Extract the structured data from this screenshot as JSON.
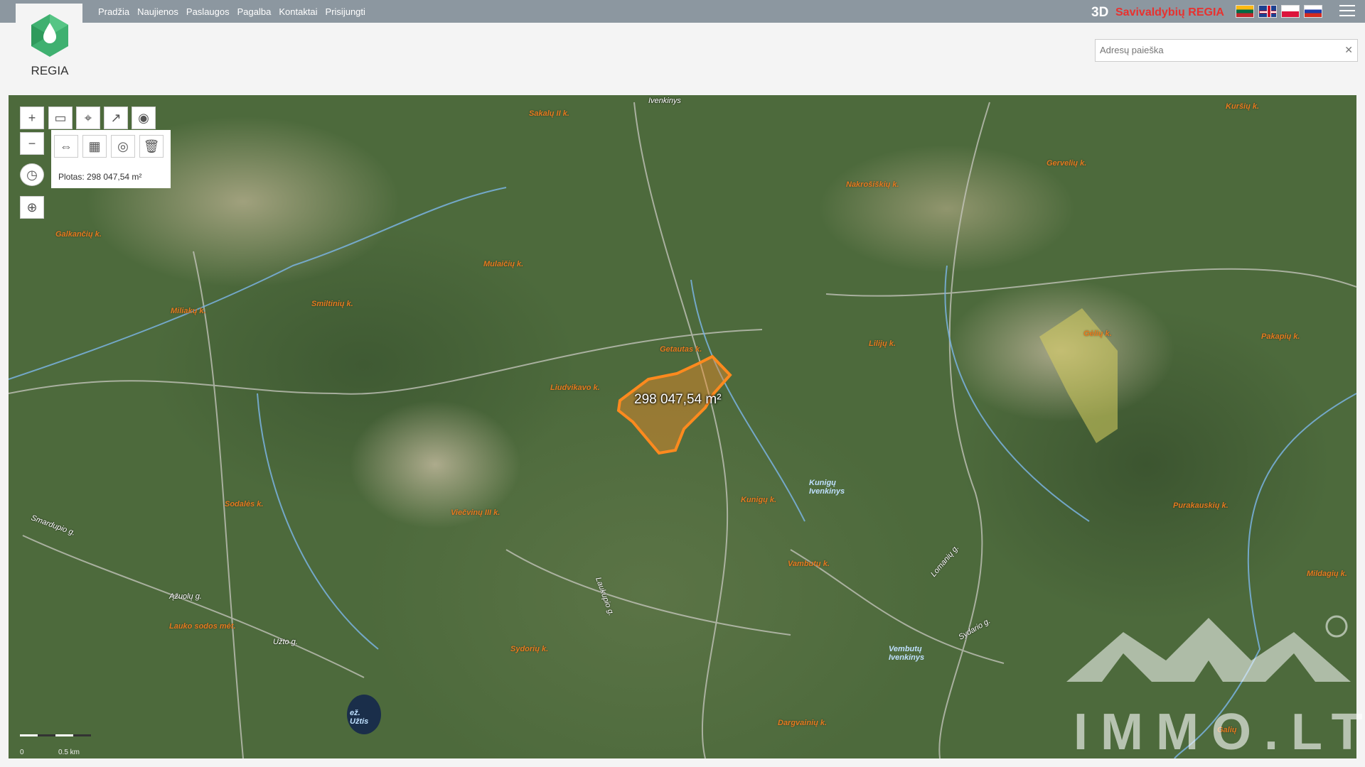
{
  "nav": {
    "items": [
      "Pradžia",
      "Naujienos",
      "Paslaugos",
      "Pagalba",
      "Kontaktai",
      "Prisijungti"
    ]
  },
  "brand": {
    "three_d": "3D",
    "name": "Savivaldybių REGIA",
    "logo_text": "REGIA",
    "accent_color": "#e8312f",
    "logo_color": "#3fb070"
  },
  "languages": [
    "lt-flag",
    "en-flag",
    "pl-flag",
    "ru-flag"
  ],
  "search": {
    "placeholder": "Adresų paieška",
    "value": ""
  },
  "measure": {
    "area_readout": "Plotas: 298 047,54 m²",
    "polygon_label": "298 047,54 m²"
  },
  "map": {
    "place_labels": [
      "Sakalų II k.",
      "Kuršių k.",
      "Gervelių k.",
      "Nakrošiškių k.",
      "Galkančių k.",
      "Mulaičių k.",
      "Smiltinių k.",
      "Miliakų k.",
      "Getautas k.",
      "Liudvikavo k.",
      "Lilijų k.",
      "Gėlių k.",
      "Pakapių k.",
      "Kunigų Ivenkinys",
      "Kunigų k.",
      "Sodalės k.",
      "Viečvinų III k.",
      "Vambutų k.",
      "Mildagių k.",
      "Purakauskių k.",
      "Lauko sodos mėt.",
      "Sydorių k.",
      "Vembutų Ivenkinys",
      "Dargvainių k.",
      "Galių"
    ],
    "road_labels": [
      "Ivenkinys",
      "Smardupio g.",
      "Užto g.",
      "Laukupio g.",
      "Ąžuolų g.",
      "Sydario g.",
      "Lomanių g."
    ],
    "water_labels": [
      "ež. Užtis"
    ],
    "scale_label": "0.5 km",
    "scale_zero": "0"
  },
  "watermark": {
    "text": "IMMO.LT"
  },
  "tools": {
    "zoom_in": "+",
    "zoom_out": "−"
  }
}
